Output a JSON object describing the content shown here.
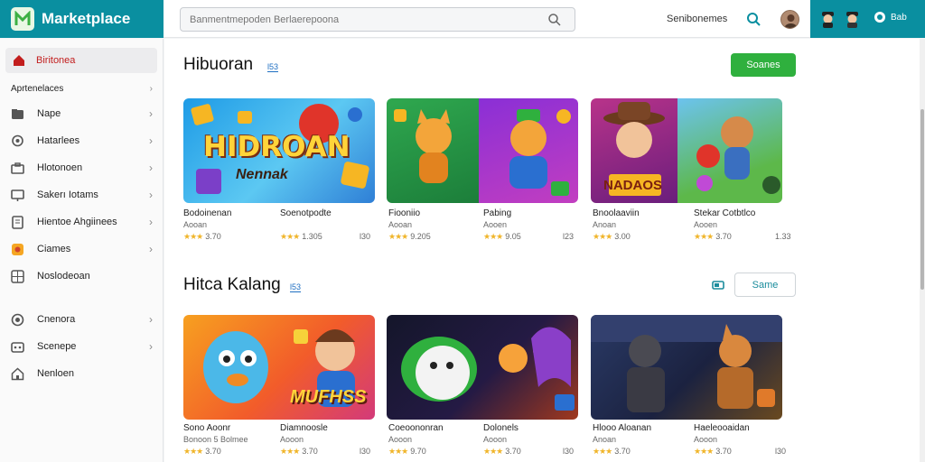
{
  "header": {
    "app_title": "Marketplace",
    "search_placeholder": "Banmentmepoden Berlaerepoona",
    "header_text": "Senibonemes",
    "badge_text": "Bab"
  },
  "sidebar": {
    "active_item": "Biritonea",
    "section_title": "Aprtenelaces",
    "items": [
      {
        "label": "Nape",
        "icon": "folder-icon",
        "chevron": true
      },
      {
        "label": "Hatarlees",
        "icon": "chat-icon",
        "chevron": true
      },
      {
        "label": "Hlotonoen",
        "icon": "briefcase-icon",
        "chevron": true
      },
      {
        "label": "Sakerı Iotams",
        "icon": "monitor-icon",
        "chevron": true
      },
      {
        "label": "Hientoe Ahgiinees",
        "icon": "tablet-icon",
        "chevron": true
      },
      {
        "label": "Ciames",
        "icon": "games-icon",
        "chevron": true
      },
      {
        "label": "Noslodeoan",
        "icon": "grid-icon",
        "chevron": false
      },
      {
        "label": "Cnenora",
        "icon": "globe-icon",
        "chevron": true
      },
      {
        "label": "Scenepe",
        "icon": "gamepad-icon",
        "chevron": true
      },
      {
        "label": "Nenloen",
        "icon": "home-icon",
        "chevron": false
      }
    ]
  },
  "section1": {
    "title": "Hibuoran",
    "count": "l53",
    "button": "Soanes",
    "cards": [
      {
        "banner_text": "HIDROAN",
        "banner_sub": "Nennak",
        "apps": [
          {
            "title": "Bodoinenan",
            "sub": "Aooan",
            "rating": "3.70",
            "size": ""
          },
          {
            "title": "Soenotpodte",
            "sub": "",
            "rating": "1.305",
            "size": "l30"
          }
        ]
      },
      {
        "apps": [
          {
            "title": "Fiooniio",
            "sub": "Aooan",
            "rating": "9.205",
            "size": ""
          },
          {
            "title": "Pabing",
            "sub": "Aooen",
            "rating": "9.05",
            "size": "l23"
          }
        ]
      },
      {
        "banner_text": "NADAOS",
        "apps": [
          {
            "title": "Bnoolaaviin",
            "sub": "Anoan",
            "rating": "3.00",
            "size": ""
          },
          {
            "title": "Stekar Cotbtlco",
            "sub": "Aooen",
            "rating": "3.70",
            "size": "1.33"
          }
        ]
      }
    ]
  },
  "section2": {
    "title": "Hitca Kalang",
    "count": "l53",
    "button": "Same",
    "cards": [
      {
        "banner_text": "MUFHSS",
        "apps": [
          {
            "title": "Sono Aoonr",
            "sub": "Bonoon 5 Bolmee",
            "rating": "3.70",
            "size": ""
          },
          {
            "title": "Diamnoosle",
            "sub": "Aooon",
            "rating": "3.70",
            "size": "l30"
          }
        ]
      },
      {
        "apps": [
          {
            "title": "Coeoononran",
            "sub": "Aooon",
            "rating": "9.70",
            "size": ""
          },
          {
            "title": "Dolonels",
            "sub": "Aooon",
            "rating": "3.70",
            "size": "l30"
          }
        ]
      },
      {
        "apps": [
          {
            "title": "Hlooo Aloanan",
            "sub": "Anoan",
            "rating": "3.70",
            "size": ""
          },
          {
            "title": "Haeleooaidan",
            "sub": "Aooon",
            "rating": "3.70",
            "size": "l30"
          }
        ]
      }
    ]
  },
  "colors": {
    "brand": "#0a8fa0",
    "accent_green": "#2fb03e",
    "active_red": "#c21d1d",
    "star": "#f0b52a"
  }
}
